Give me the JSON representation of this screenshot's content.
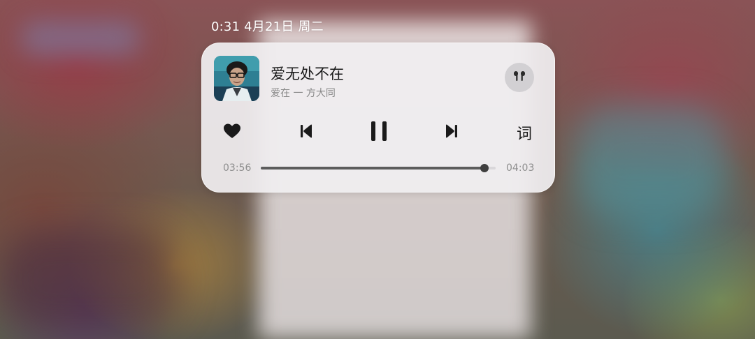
{
  "status_bar": {
    "datetime": "0:31 4月21日 周二"
  },
  "player": {
    "title": "爱无处不在",
    "subtitle": "爱在 一 方大同",
    "elapsed": "03:56",
    "duration": "04:03",
    "progress": 0.953,
    "lyrics_label": "词",
    "output_device_icon": "airpods-icon",
    "icons": {
      "favorite": "heart-icon",
      "previous": "skip-previous-icon",
      "play_state": "pause-icon",
      "next": "skip-next-icon"
    },
    "colors": {
      "card_bg": "#f0eef0",
      "progress_fill": "#5c5c5c",
      "progress_track": "#d9d7da"
    }
  }
}
